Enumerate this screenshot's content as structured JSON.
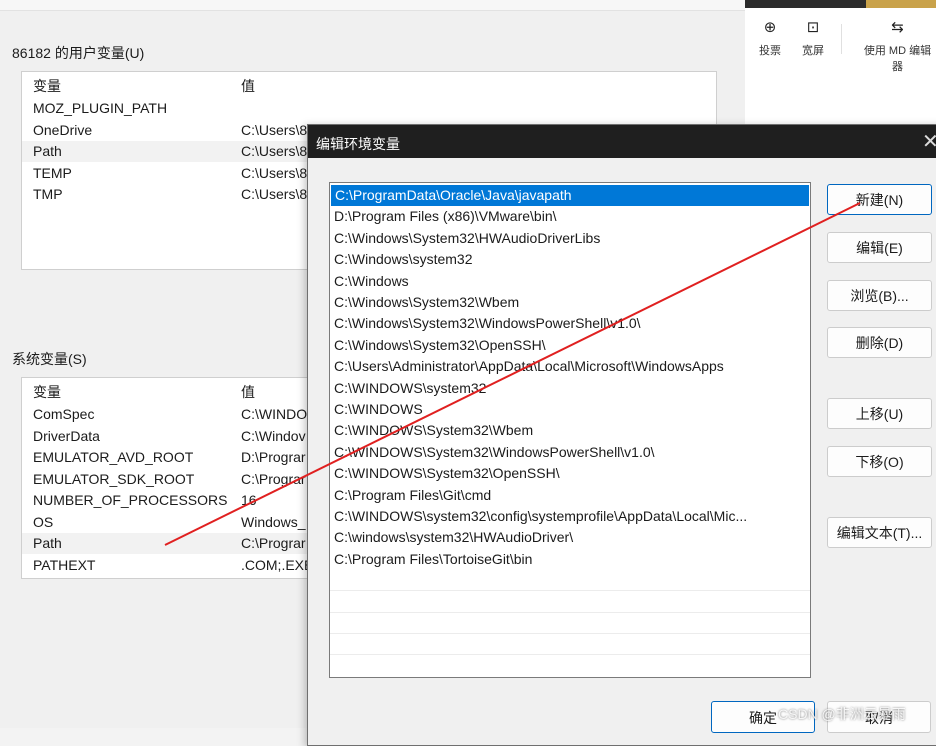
{
  "user_vars": {
    "label": "86182 的用户变量(U)",
    "header": {
      "name": "变量",
      "value": "值"
    },
    "rows": [
      {
        "name": "MOZ_PLUGIN_PATH",
        "value": ""
      },
      {
        "name": "OneDrive",
        "value": "C:\\Users\\8"
      },
      {
        "name": "Path",
        "value": "C:\\Users\\8"
      },
      {
        "name": "TEMP",
        "value": "C:\\Users\\8"
      },
      {
        "name": "TMP",
        "value": "C:\\Users\\8"
      }
    ]
  },
  "system_vars": {
    "label": "系统变量(S)",
    "header": {
      "name": "变量",
      "value": "值"
    },
    "rows": [
      {
        "name": "ComSpec",
        "value": "C:\\WINDO"
      },
      {
        "name": "DriverData",
        "value": "C:\\Windov"
      },
      {
        "name": "EMULATOR_AVD_ROOT",
        "value": "D:\\Prograr"
      },
      {
        "name": "EMULATOR_SDK_ROOT",
        "value": "C:\\Prograr"
      },
      {
        "name": "NUMBER_OF_PROCESSORS",
        "value": "16"
      },
      {
        "name": "OS",
        "value": "Windows_"
      },
      {
        "name": "Path",
        "value": "C:\\Prograr"
      },
      {
        "name": "PATHEXT",
        "value": ".COM;.EXE"
      }
    ]
  },
  "toolbar": {
    "items": [
      {
        "icon": "camera-icon",
        "glyph": "⊕",
        "label": "投票"
      },
      {
        "icon": "fullscreen-icon",
        "glyph": "⊡",
        "label": "宽屏"
      },
      {
        "icon": "md-editor-icon",
        "glyph": "⇆",
        "label": "使用 MD 编辑器"
      }
    ]
  },
  "dialog": {
    "title": "编辑环境变量",
    "close_glyph": "✕",
    "paths": [
      "C:\\ProgramData\\Oracle\\Java\\javapath",
      "D:\\Program Files (x86)\\VMware\\bin\\",
      "C:\\Windows\\System32\\HWAudioDriverLibs",
      "C:\\Windows\\system32",
      "C:\\Windows",
      "C:\\Windows\\System32\\Wbem",
      "C:\\Windows\\System32\\WindowsPowerShell\\v1.0\\",
      "C:\\Windows\\System32\\OpenSSH\\",
      "C:\\Users\\Administrator\\AppData\\Local\\Microsoft\\WindowsApps",
      "C:\\WINDOWS\\system32",
      "C:\\WINDOWS",
      "C:\\WINDOWS\\System32\\Wbem",
      "C:\\WINDOWS\\System32\\WindowsPowerShell\\v1.0\\",
      "C:\\WINDOWS\\System32\\OpenSSH\\",
      "C:\\Program Files\\Git\\cmd",
      "C:\\WINDOWS\\system32\\config\\systemprofile\\AppData\\Local\\Mic...",
      "C:\\windows\\system32\\HWAudioDriver\\",
      "C:\\Program Files\\TortoiseGit\\bin"
    ],
    "selected_index": 0,
    "buttons": {
      "new": "新建(N)",
      "edit": "编辑(E)",
      "browse": "浏览(B)...",
      "delete": "删除(D)",
      "move_up": "上移(U)",
      "move_down": "下移(O)",
      "edit_text": "编辑文本(T)..."
    },
    "footer": {
      "ok": "确定",
      "cancel": "取消"
    }
  },
  "watermark": "CSDN @非洲云暴雨",
  "colors": {
    "selection": "#0078d7",
    "annotation": "#e02020",
    "titlebar": "#1f1f1f"
  }
}
